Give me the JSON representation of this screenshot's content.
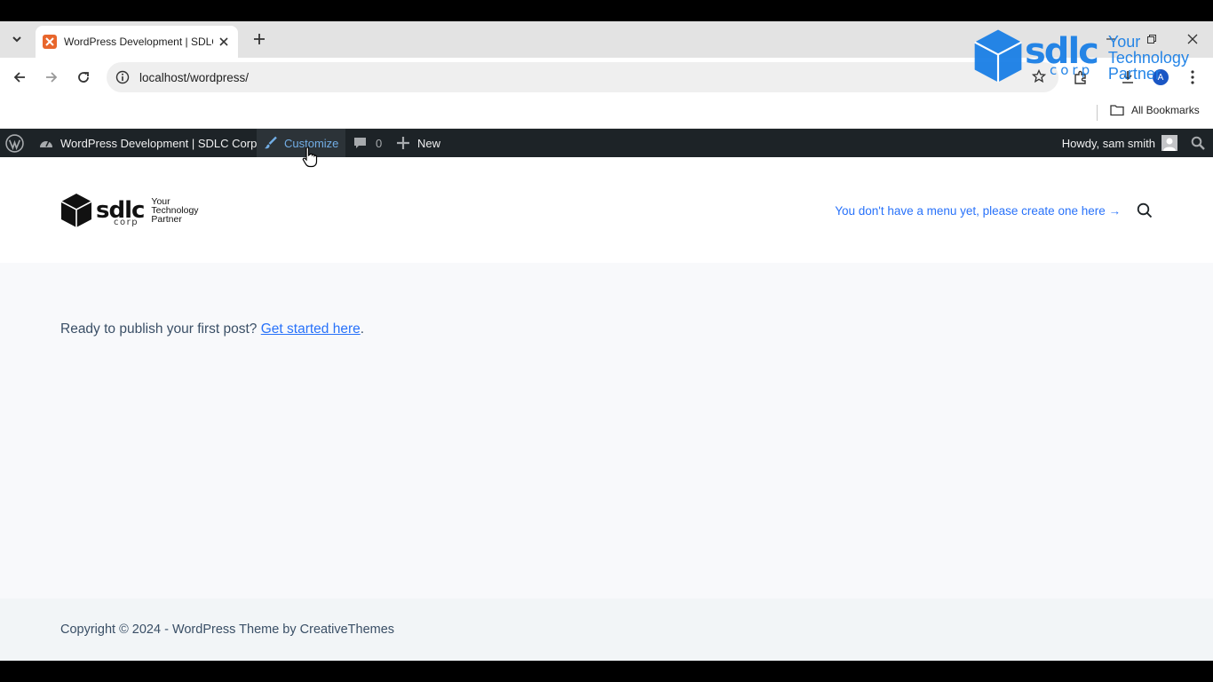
{
  "browser": {
    "tab_title": "WordPress Development | SDLC Corp",
    "url": "localhost/wordpress/",
    "bookmarks_label": "All Bookmarks",
    "profile_initial": "A"
  },
  "adminbar": {
    "site_name": "WordPress Development | SDLC Corp",
    "customize": "Customize",
    "comments_count": "0",
    "new": "New",
    "howdy": "Howdy, sam smith"
  },
  "site": {
    "logo_word": "sdlc",
    "logo_corp": "corp",
    "logo_tagline": [
      "Your",
      "Technology",
      "Partner"
    ],
    "menu_notice": "You don't have a menu yet, please create one here →"
  },
  "main": {
    "ready_text": "Ready to publish your first post?",
    "get_started": "Get started here",
    "period": "."
  },
  "footer": {
    "copyright": "Copyright © 2024 - WordPress Theme by CreativeThemes"
  },
  "watermark": {
    "word": "sdlc",
    "corp": "corp",
    "tagline": [
      "Your",
      "Technology",
      "Partner"
    ]
  },
  "colors": {
    "adminbar_bg": "#1d2327",
    "link_blue": "#2872fa",
    "admin_highlight": "#72aee6",
    "watermark_blue": "#1a7fe6"
  }
}
